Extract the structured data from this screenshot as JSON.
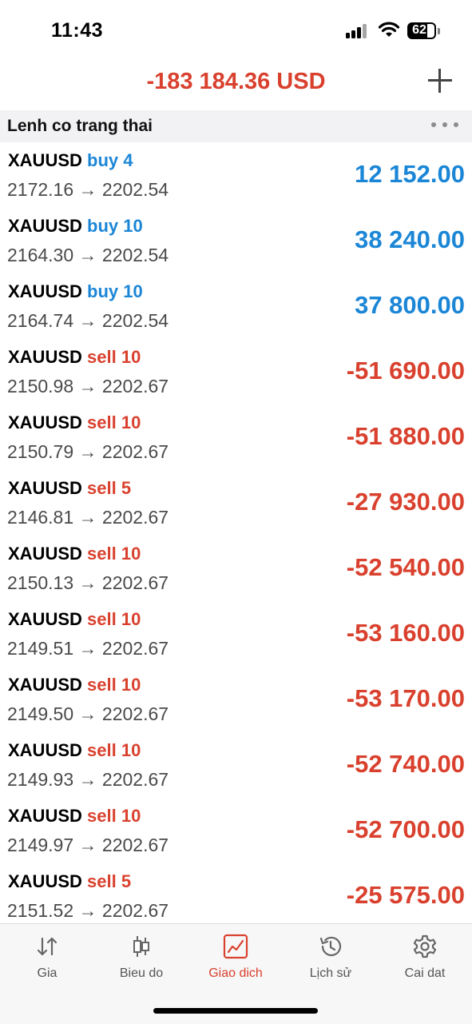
{
  "status": {
    "time": "11:43",
    "battery": "62"
  },
  "header": {
    "total": "-183 184.36 USD"
  },
  "section": {
    "title": "Lenh co trang thai"
  },
  "orders": [
    {
      "symbol": "XAUUSD",
      "direction": "buy 4",
      "prices": "2172.16 → 2202.54",
      "profit": "12 152.00",
      "side": "buy"
    },
    {
      "symbol": "XAUUSD",
      "direction": "buy 10",
      "prices": "2164.30 → 2202.54",
      "profit": "38 240.00",
      "side": "buy"
    },
    {
      "symbol": "XAUUSD",
      "direction": "buy 10",
      "prices": "2164.74 → 2202.54",
      "profit": "37 800.00",
      "side": "buy"
    },
    {
      "symbol": "XAUUSD",
      "direction": "sell 10",
      "prices": "2150.98 → 2202.67",
      "profit": "-51 690.00",
      "side": "sell"
    },
    {
      "symbol": "XAUUSD",
      "direction": "sell 10",
      "prices": "2150.79 → 2202.67",
      "profit": "-51 880.00",
      "side": "sell"
    },
    {
      "symbol": "XAUUSD",
      "direction": "sell 5",
      "prices": "2146.81 → 2202.67",
      "profit": "-27 930.00",
      "side": "sell"
    },
    {
      "symbol": "XAUUSD",
      "direction": "sell 10",
      "prices": "2150.13 → 2202.67",
      "profit": "-52 540.00",
      "side": "sell"
    },
    {
      "symbol": "XAUUSD",
      "direction": "sell 10",
      "prices": "2149.51 → 2202.67",
      "profit": "-53 160.00",
      "side": "sell"
    },
    {
      "symbol": "XAUUSD",
      "direction": "sell 10",
      "prices": "2149.50 → 2202.67",
      "profit": "-53 170.00",
      "side": "sell"
    },
    {
      "symbol": "XAUUSD",
      "direction": "sell 10",
      "prices": "2149.93 → 2202.67",
      "profit": "-52 740.00",
      "side": "sell"
    },
    {
      "symbol": "XAUUSD",
      "direction": "sell 10",
      "prices": "2149.97 → 2202.67",
      "profit": "-52 700.00",
      "side": "sell"
    },
    {
      "symbol": "XAUUSD",
      "direction": "sell 5",
      "prices": "2151.52 → 2202.67",
      "profit": "-25 575.00",
      "side": "sell"
    }
  ],
  "tabs": [
    {
      "label": "Gia",
      "icon": "arrows-updown-icon",
      "active": false
    },
    {
      "label": "Bieu do",
      "icon": "candlestick-icon",
      "active": false
    },
    {
      "label": "Giao dich",
      "icon": "trade-chart-icon",
      "active": true
    },
    {
      "label": "Lịch sử",
      "icon": "history-icon",
      "active": false
    },
    {
      "label": "Cai dat",
      "icon": "gear-icon",
      "active": false
    }
  ],
  "colors": {
    "buy": "#1b86d6",
    "sell": "#d9412e",
    "active_tab": "#d9412e"
  }
}
